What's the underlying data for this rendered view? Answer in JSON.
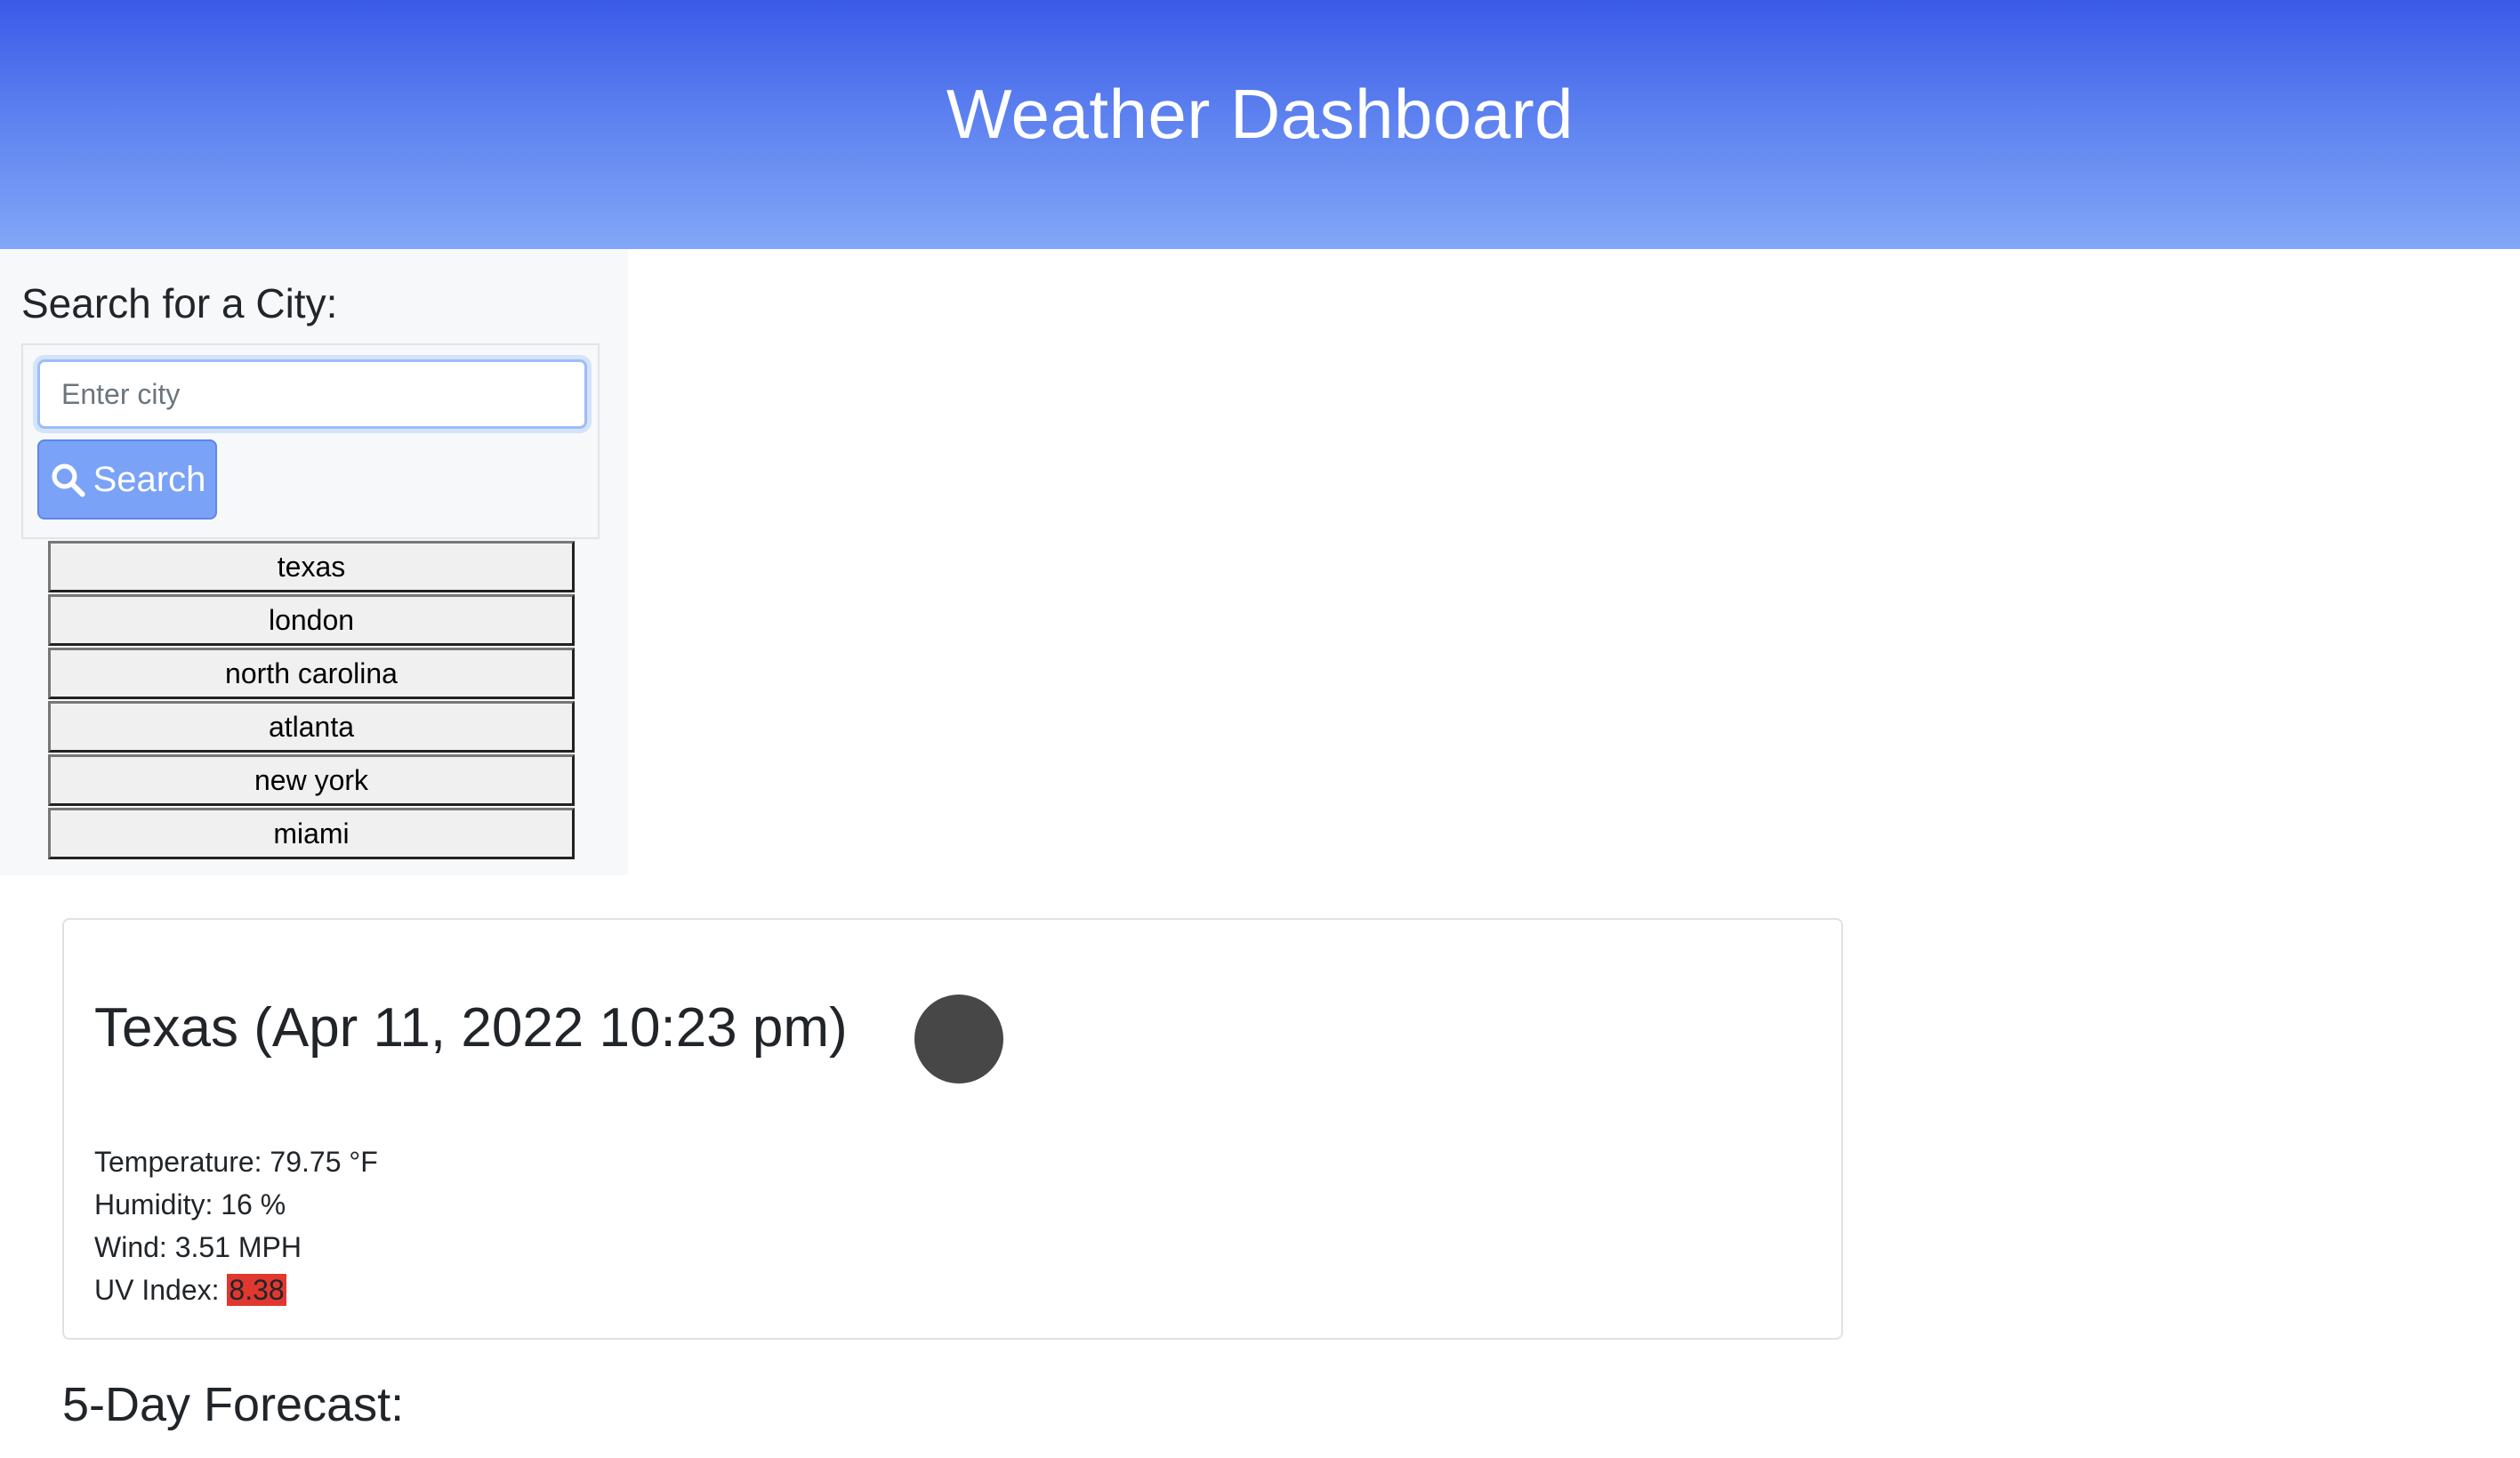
{
  "header": {
    "title": "Weather Dashboard"
  },
  "sidebar": {
    "heading": "Search for a City:",
    "search": {
      "placeholder": "Enter city",
      "value": "",
      "button_label": "Search",
      "button_icon": "search-icon"
    },
    "history": [
      "texas",
      "london",
      "north carolina",
      "atlanta",
      "new york",
      "miami"
    ]
  },
  "current": {
    "title": "Texas (Apr 11, 2022 10:23 pm)",
    "icon": "weather-icon",
    "temperature_label": "Temperature: ",
    "temperature_value": "79.75 °F",
    "humidity_label": "Humidity: ",
    "humidity_value": "16 %",
    "wind_label": "Wind: ",
    "wind_value": "3.51 MPH",
    "uv_label": "UV Index: ",
    "uv_value": "8.38"
  },
  "forecast": {
    "title": "5-Day Forecast:"
  },
  "colors": {
    "header_top": "#3a5ae8",
    "header_bottom": "#82a7f7",
    "search_button": "#7aa2f7",
    "uv_severe": "#e0382f"
  }
}
